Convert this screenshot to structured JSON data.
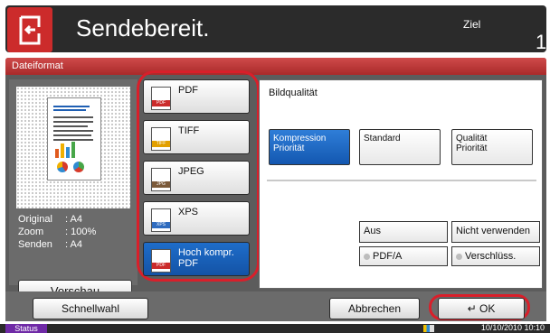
{
  "header": {
    "title": "Sendebereit.",
    "ziel_label": "Ziel",
    "ziel_count": "1"
  },
  "dialog": {
    "title": "Dateiformat"
  },
  "preview": {
    "original_label": "Original",
    "original_value": ": A4",
    "zoom_label": "Zoom",
    "zoom_value": ": 100%",
    "send_label": "Senden",
    "send_value": ": A4",
    "button_label": "Vorschau"
  },
  "formats": [
    {
      "label": "PDF",
      "icon": "pdf-icon",
      "selected": false
    },
    {
      "label": "TIFF",
      "icon": "tiff-icon",
      "selected": false
    },
    {
      "label": "JPEG",
      "icon": "jpeg-icon",
      "selected": false
    },
    {
      "label": "XPS",
      "icon": "xps-icon",
      "selected": false
    },
    {
      "label": "Hoch kompr.\nPDF",
      "icon": "high-compression-pdf-icon",
      "selected": true
    }
  ],
  "settings": {
    "quality_label": "Bildqualität",
    "quality_options": [
      {
        "label": "Kompression\nPriorität",
        "selected": true
      },
      {
        "label": "Standard",
        "selected": false
      },
      {
        "label": "Qualität\nPriorität",
        "selected": false
      }
    ],
    "pdfa_off": "Aus",
    "pdfa_label": "PDF/A",
    "encryption_off": "Nicht verwenden",
    "encryption_label": "Verschlüss."
  },
  "footer": {
    "quick_setup": "Schnellwahl",
    "cancel": "Abbrechen",
    "ok": "OK"
  },
  "status_bar": {
    "status_label": "Status",
    "datetime": "10/10/2010  10:10"
  }
}
